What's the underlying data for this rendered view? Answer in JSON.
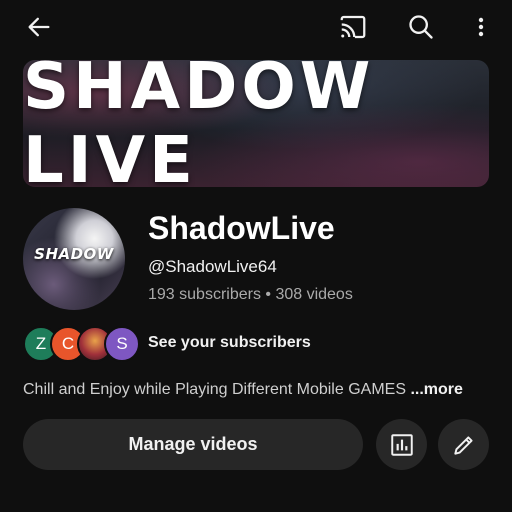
{
  "header": {
    "back_icon": "arrow-left-icon",
    "cast_icon": "cast-icon",
    "search_icon": "search-icon",
    "more_icon": "more-vert-icon"
  },
  "banner": {
    "text": "SHADOW LIVE"
  },
  "channel": {
    "avatar_text": "SHADOW",
    "name": "ShadowLive",
    "handle": "@ShadowLive64",
    "stats": "193 subscribers • 308 videos"
  },
  "subscribers": {
    "avatars": [
      {
        "letter": "Z",
        "color": "#1e7d5a"
      },
      {
        "letter": "C",
        "color": "#e8552b"
      },
      {
        "letter": "",
        "color": "#a0303a"
      },
      {
        "letter": "S",
        "color": "#7e57c2"
      }
    ],
    "label": "See your subscribers"
  },
  "description": {
    "text": "Chill and Enjoy while Playing Different Mobile GAMES ",
    "more": "...more"
  },
  "actions": {
    "manage_label": "Manage videos",
    "analytics_icon": "analytics-icon",
    "edit_icon": "pencil-icon"
  }
}
